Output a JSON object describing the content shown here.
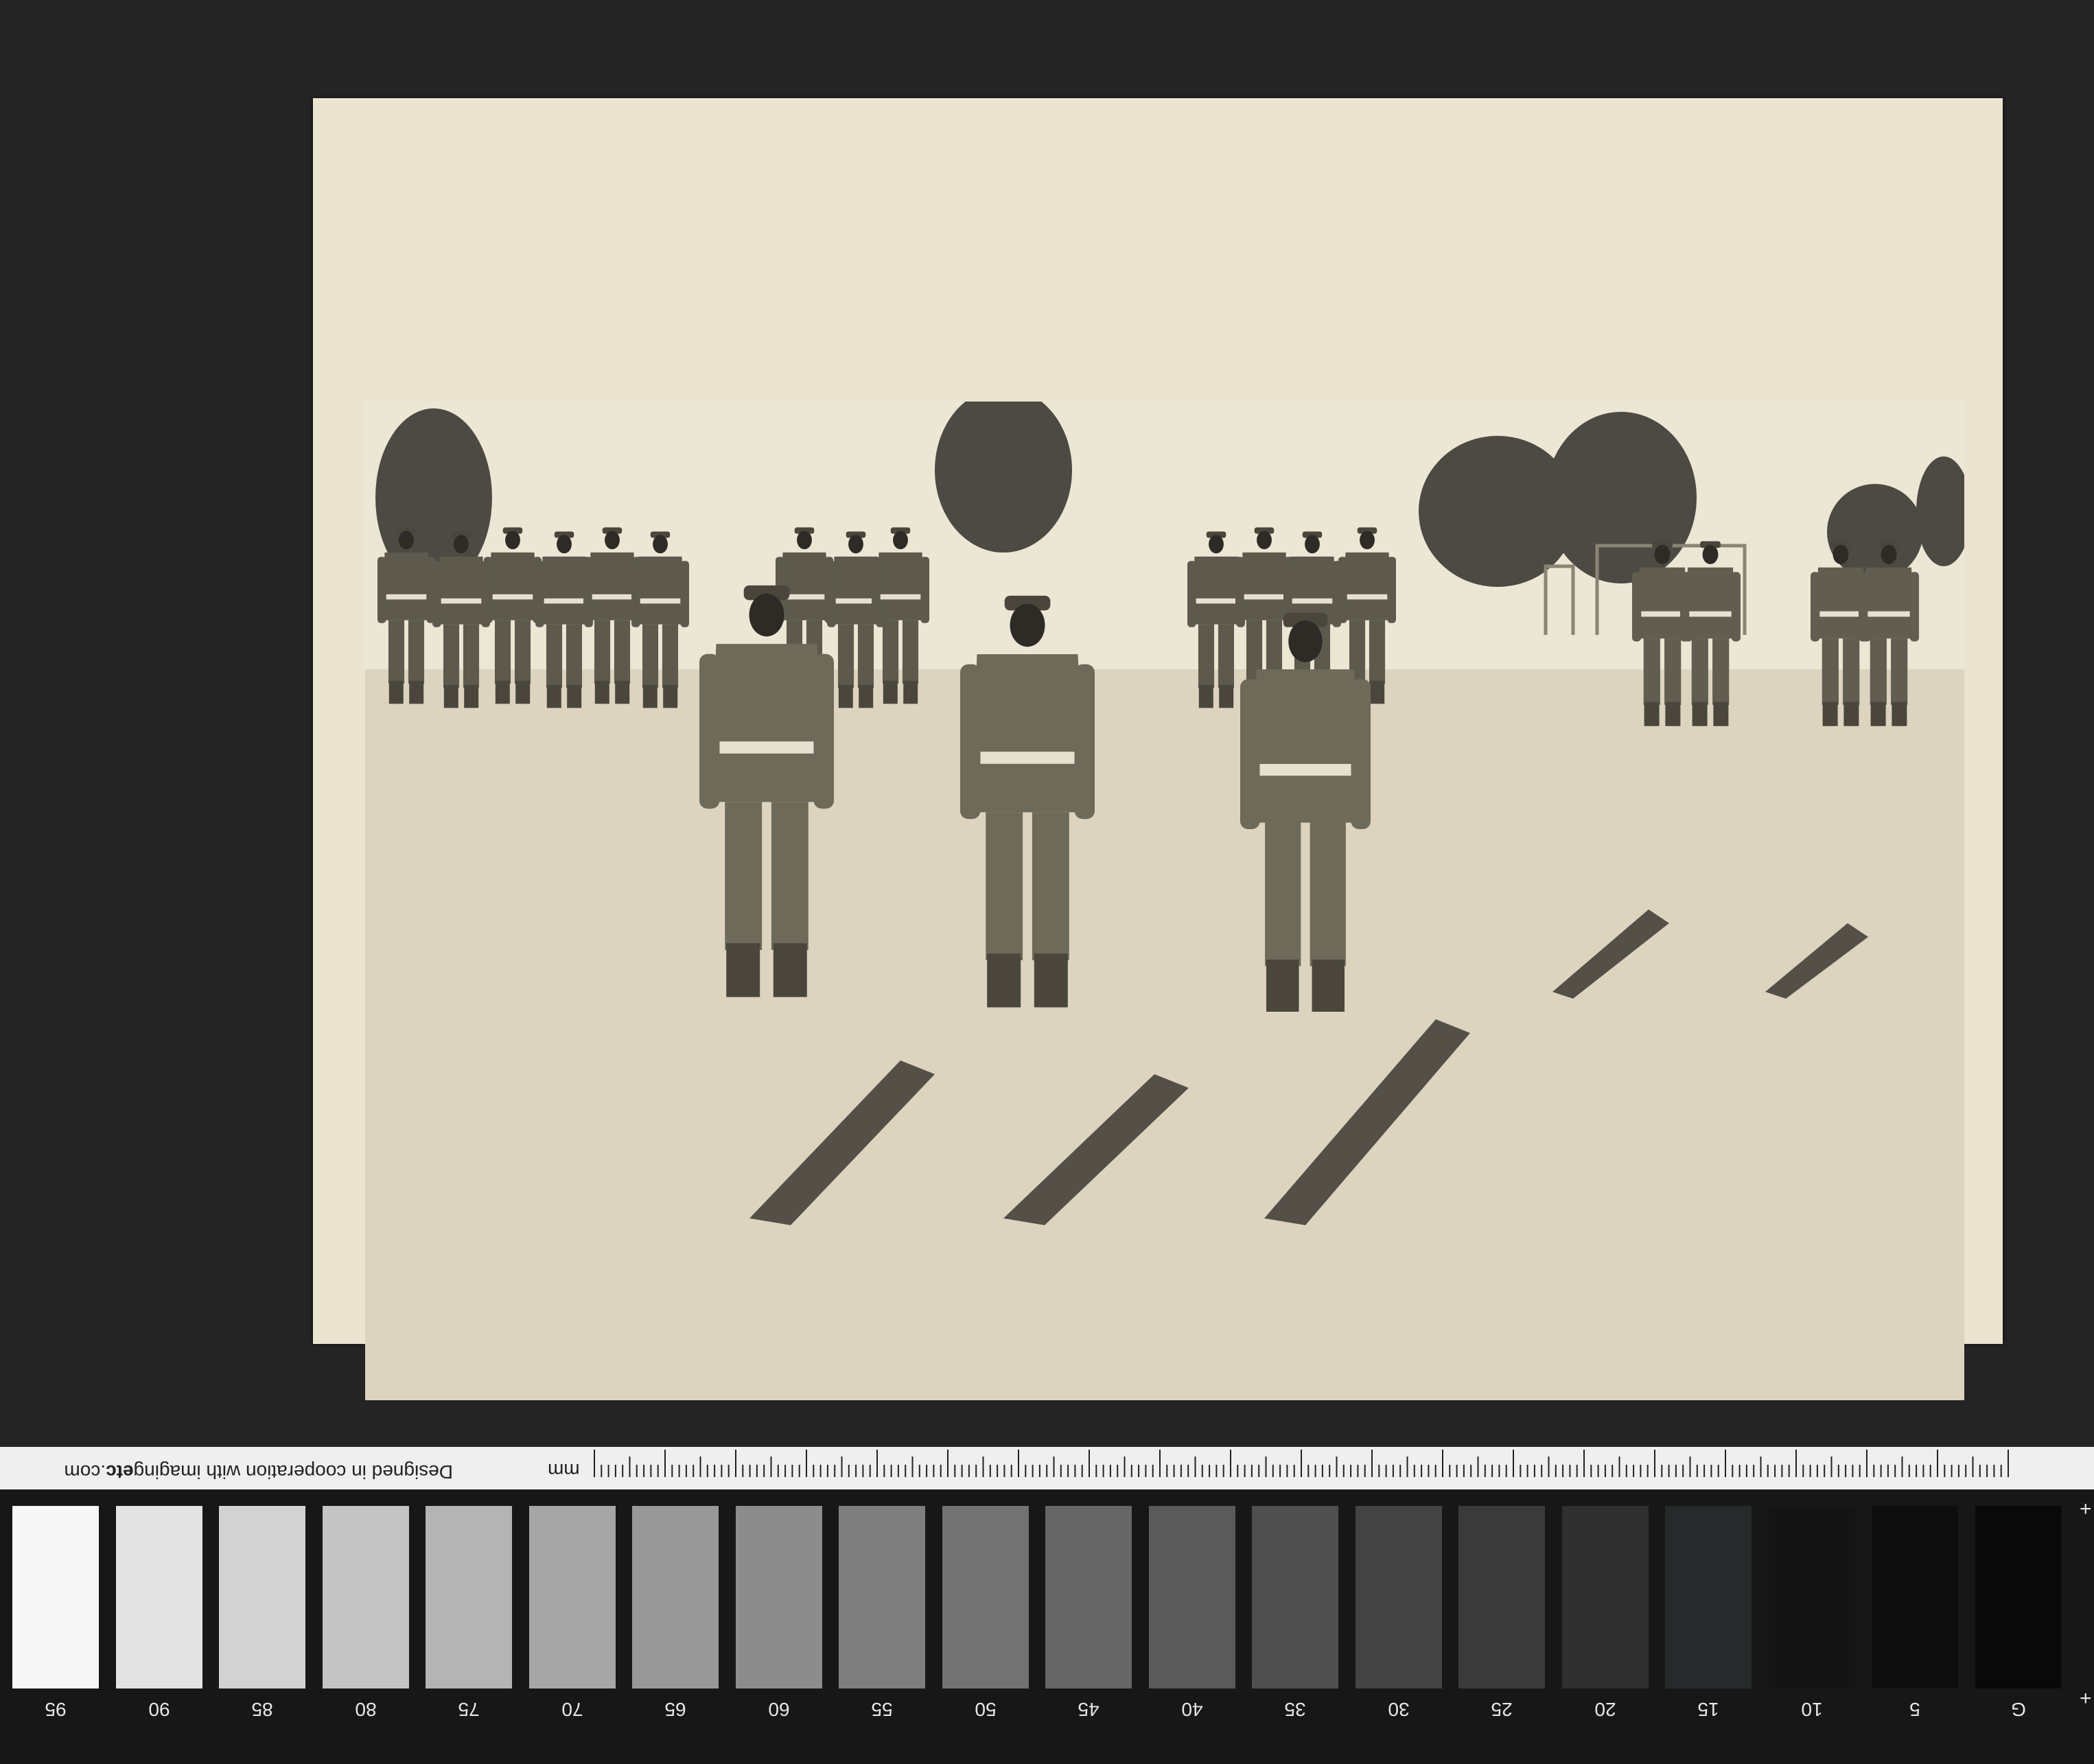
{
  "target": {
    "credit_prefix": "Designed in cooperation with imaging",
    "credit_bold": "etc",
    "credit_suffix": ".com",
    "unit": "mm",
    "patch_labels": [
      "95",
      "90",
      "85",
      "80",
      "75",
      "70",
      "65",
      "60",
      "55",
      "50",
      "45",
      "40",
      "35",
      "30",
      "25",
      "20",
      "15",
      "10",
      "5",
      "G"
    ],
    "patch_colors": [
      "#f7f7f7",
      "#e3e3e3",
      "#d2d2d2",
      "#c4c4c4",
      "#b4b4b4",
      "#a6a6a6",
      "#989898",
      "#8c8c8c",
      "#7e7e7e",
      "#727272",
      "#666666",
      "#5a5a5a",
      "#4f4f4f",
      "#444444",
      "#3a3a3a",
      "#303030",
      "#262a2b",
      "#141414",
      "#0e0e0e",
      "#090909"
    ],
    "plus_top": "+",
    "plus_bottom": "+"
  },
  "photo": {
    "subject": "soldiers-in-formation",
    "palette": {
      "paper": "#ebe4d1",
      "sky": "#ece6d5",
      "ground": "#ddd4bf",
      "uniform": "#6e6a5a",
      "uniform_dark": "#4a463c",
      "shadow": "#3a3630"
    }
  }
}
